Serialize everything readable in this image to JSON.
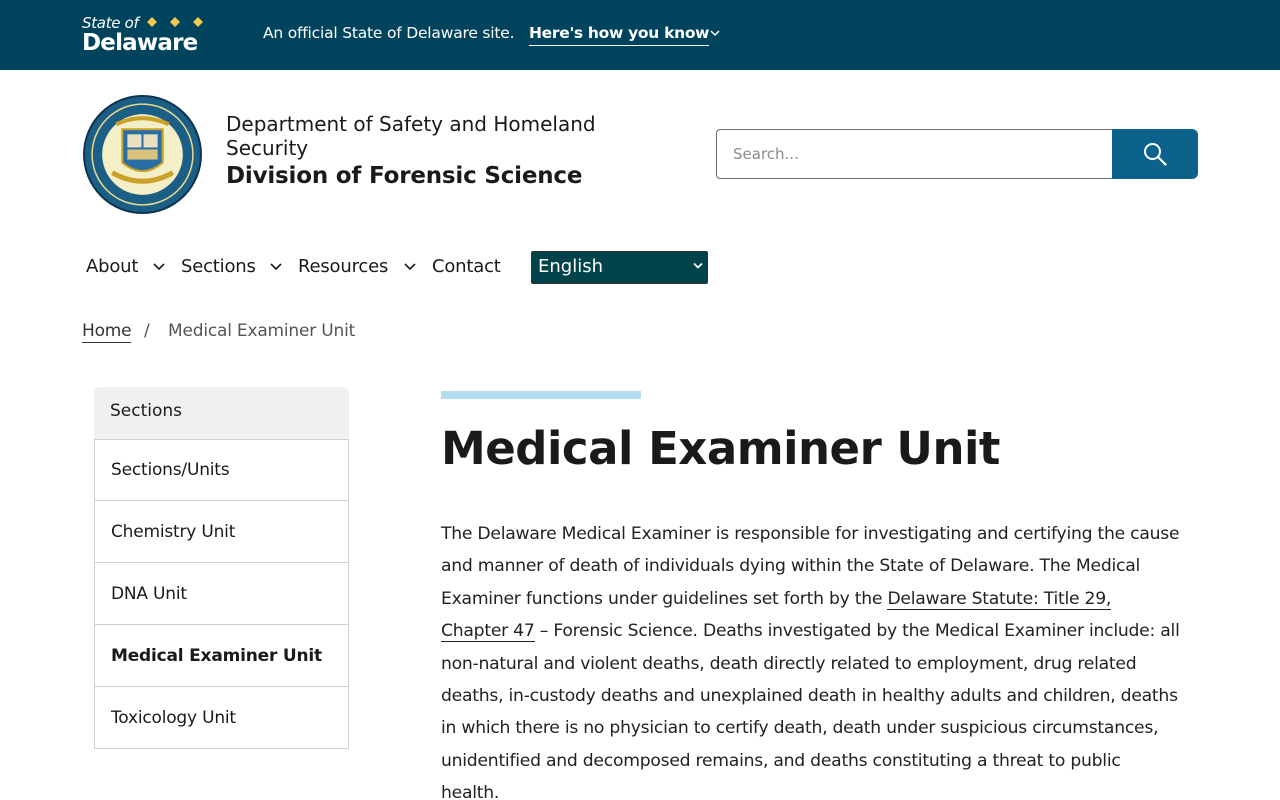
{
  "banner": {
    "state_of": "State of",
    "delaware": "Delaware",
    "official_text": "An official State of Delaware site.",
    "how_you_know": "Here's how you know"
  },
  "header": {
    "department": "Department of Safety and Homeland Security",
    "division": "Division of Forensic Science"
  },
  "search": {
    "placeholder": "Search..."
  },
  "nav": {
    "items": [
      {
        "label": "About",
        "has_dropdown": true
      },
      {
        "label": "Sections",
        "has_dropdown": true
      },
      {
        "label": "Resources",
        "has_dropdown": true
      },
      {
        "label": "Contact",
        "has_dropdown": false
      }
    ],
    "language": "English"
  },
  "breadcrumb": {
    "home": "Home",
    "separator": "/",
    "current": "Medical Examiner Unit"
  },
  "sidebar": {
    "heading": "Sections",
    "items": [
      {
        "label": "Sections/Units",
        "active": false
      },
      {
        "label": "Chemistry Unit",
        "active": false
      },
      {
        "label": "DNA Unit",
        "active": false
      },
      {
        "label": "Medical Examiner Unit",
        "active": true
      },
      {
        "label": "Toxicology Unit",
        "active": false
      }
    ]
  },
  "main": {
    "title": "Medical Examiner Unit",
    "para_before_link": "The Delaware Medical Examiner is responsible for investigating and certifying the cause and manner of death of individuals dying within the State of Delaware. The Medical Examiner functions under guidelines set forth by the ",
    "link_text": "Delaware Statute: Title 29, Chapter 47",
    "para_after_link": " – Forensic Science. Deaths investigated by the Medical Examiner include: all non-natural and violent deaths, death directly related to employment, drug related deaths, in-custody deaths and unexplained death in healthy adults and children, deaths in which there is no physician to certify death, death under suspicious circumstances, unidentified and decomposed remains, and deaths constituting a threat to public health."
  },
  "colors": {
    "banner_bg": "#00435c",
    "search_button": "#0b628b",
    "language_select_bg": "#00434a",
    "accent_bar": "#b3dcef",
    "diamond_gold": "#f2c94c"
  },
  "icons": [
    "state-diamond-icon",
    "chevron-down-icon",
    "search-icon",
    "division-seal-icon"
  ]
}
